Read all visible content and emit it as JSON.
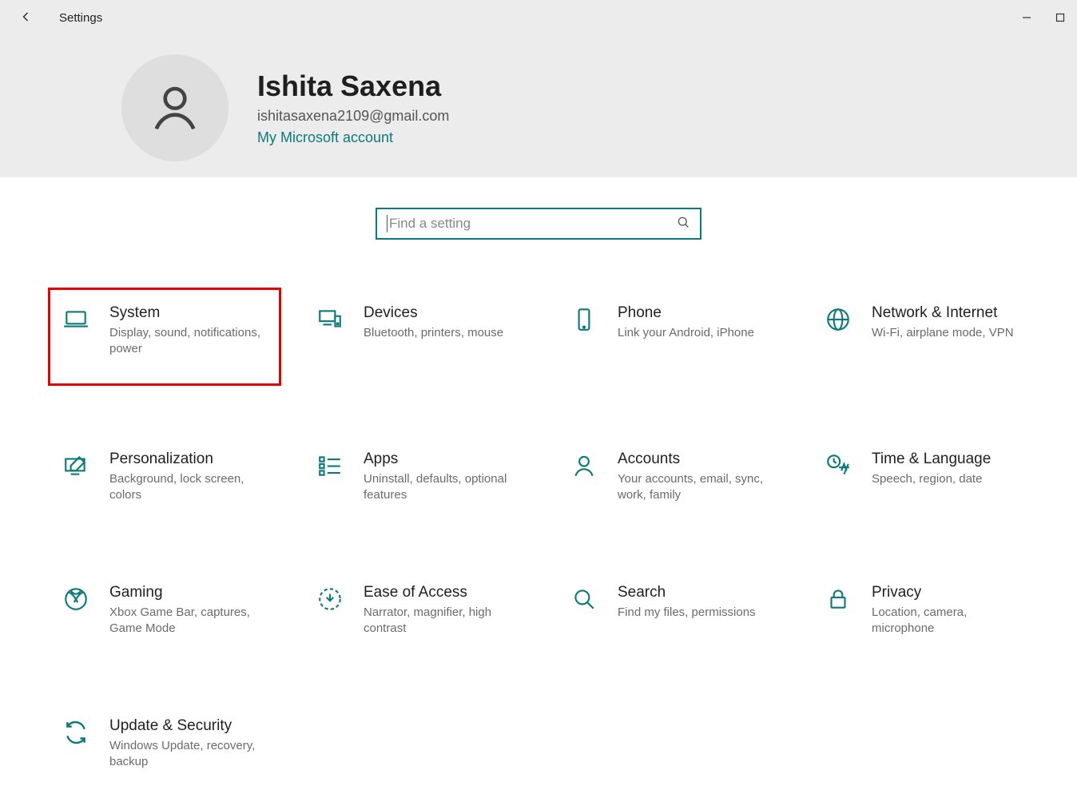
{
  "titlebar": {
    "title": "Settings"
  },
  "account": {
    "name": "Ishita Saxena",
    "email": "ishitasaxena2109@gmail.com",
    "ms_link": "My Microsoft account"
  },
  "search": {
    "placeholder": "Find a setting"
  },
  "categories": [
    {
      "title": "System",
      "desc": "Display, sound, notifications, power",
      "icon": "laptop",
      "highlighted": true
    },
    {
      "title": "Devices",
      "desc": "Bluetooth, printers, mouse",
      "icon": "devices"
    },
    {
      "title": "Phone",
      "desc": "Link your Android, iPhone",
      "icon": "phone"
    },
    {
      "title": "Network & Internet",
      "desc": "Wi-Fi, airplane mode, VPN",
      "icon": "globe"
    },
    {
      "title": "Personalization",
      "desc": "Background, lock screen, colors",
      "icon": "pen-monitor"
    },
    {
      "title": "Apps",
      "desc": "Uninstall, defaults, optional features",
      "icon": "apps-list"
    },
    {
      "title": "Accounts",
      "desc": "Your accounts, email, sync, work, family",
      "icon": "person"
    },
    {
      "title": "Time & Language",
      "desc": "Speech, region, date",
      "icon": "time-lang"
    },
    {
      "title": "Gaming",
      "desc": "Xbox Game Bar, captures, Game Mode",
      "icon": "xbox"
    },
    {
      "title": "Ease of Access",
      "desc": "Narrator, magnifier, high contrast",
      "icon": "ease"
    },
    {
      "title": "Search",
      "desc": "Find my files, permissions",
      "icon": "search-big"
    },
    {
      "title": "Privacy",
      "desc": "Location, camera, microphone",
      "icon": "lock"
    },
    {
      "title": "Update & Security",
      "desc": "Windows Update, recovery, backup",
      "icon": "sync"
    }
  ]
}
